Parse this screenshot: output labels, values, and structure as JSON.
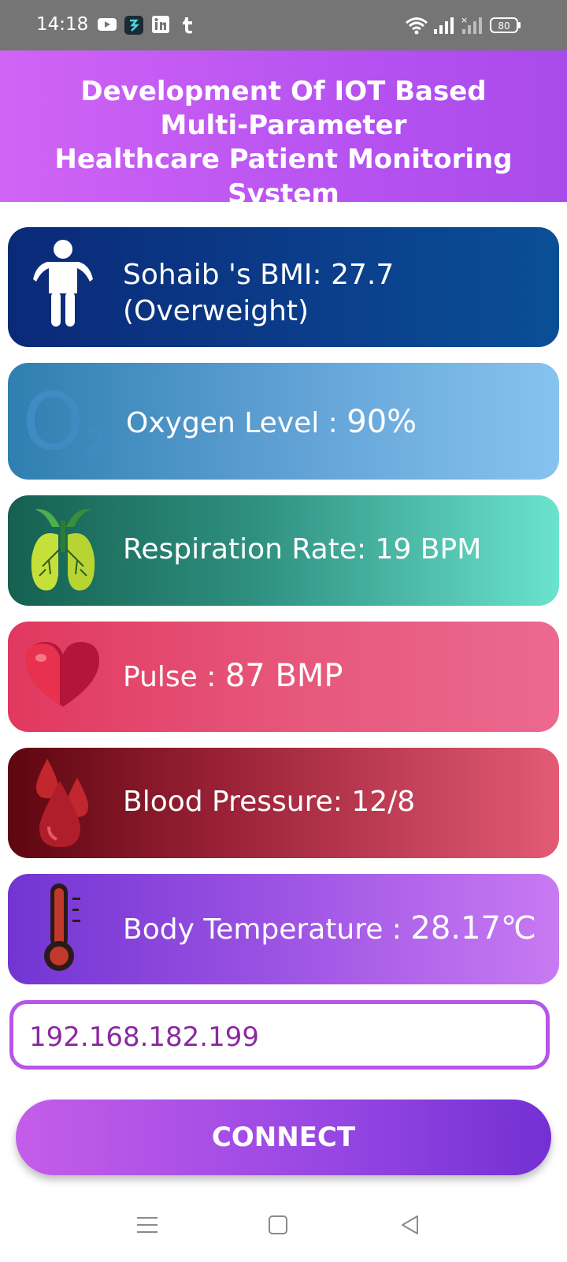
{
  "status_bar": {
    "time": "14:18",
    "battery": "80",
    "left_icons": [
      "youtube-icon",
      "app-icon",
      "linkedin-icon",
      "tumblr-icon"
    ],
    "right_icons": [
      "wifi-icon",
      "signal-icon",
      "signal-no-service-icon",
      "battery-icon"
    ]
  },
  "header": {
    "line1": "Development Of IOT Based",
    "line2": "Multi-Parameter",
    "line3": "Healthcare Patient Monitoring System"
  },
  "cards": {
    "bmi": {
      "label_line1": "Sohaib 's BMI: 27.7",
      "label_line2": "(Overweight)",
      "icon": "person-icon"
    },
    "oxygen": {
      "label": "Oxygen Level : ",
      "value": "90%",
      "icon": "o2-icon",
      "icon_text": "O",
      "icon_sub": "2"
    },
    "respiration": {
      "label": "Respiration Rate: 19 BPM",
      "icon": "lungs-icon"
    },
    "pulse": {
      "label": "Pulse : ",
      "value": "87 BMP",
      "icon": "heart-icon"
    },
    "blood_pressure": {
      "label": "Blood Pressure: 12/8",
      "icon": "blood-drops-icon"
    },
    "temperature": {
      "label": "Body Temperature : ",
      "value": "28.17℃",
      "icon": "thermometer-icon"
    }
  },
  "ip_input": {
    "value": "192.168.182.199"
  },
  "connect_button": {
    "label": "CONNECT"
  },
  "navigation": {
    "items": [
      "menu-icon",
      "home-square-icon",
      "back-triangle-icon"
    ]
  },
  "colors": {
    "header_accent": "#b350f0",
    "bmi_card": "#0b3d8a",
    "oxygen_card": "#5fa0d4",
    "respiration_card": "#2f9080",
    "pulse_card": "#e6567a",
    "bp_card": "#9b2237",
    "temperature_card": "#9950e2",
    "input_border": "#b655e8"
  }
}
